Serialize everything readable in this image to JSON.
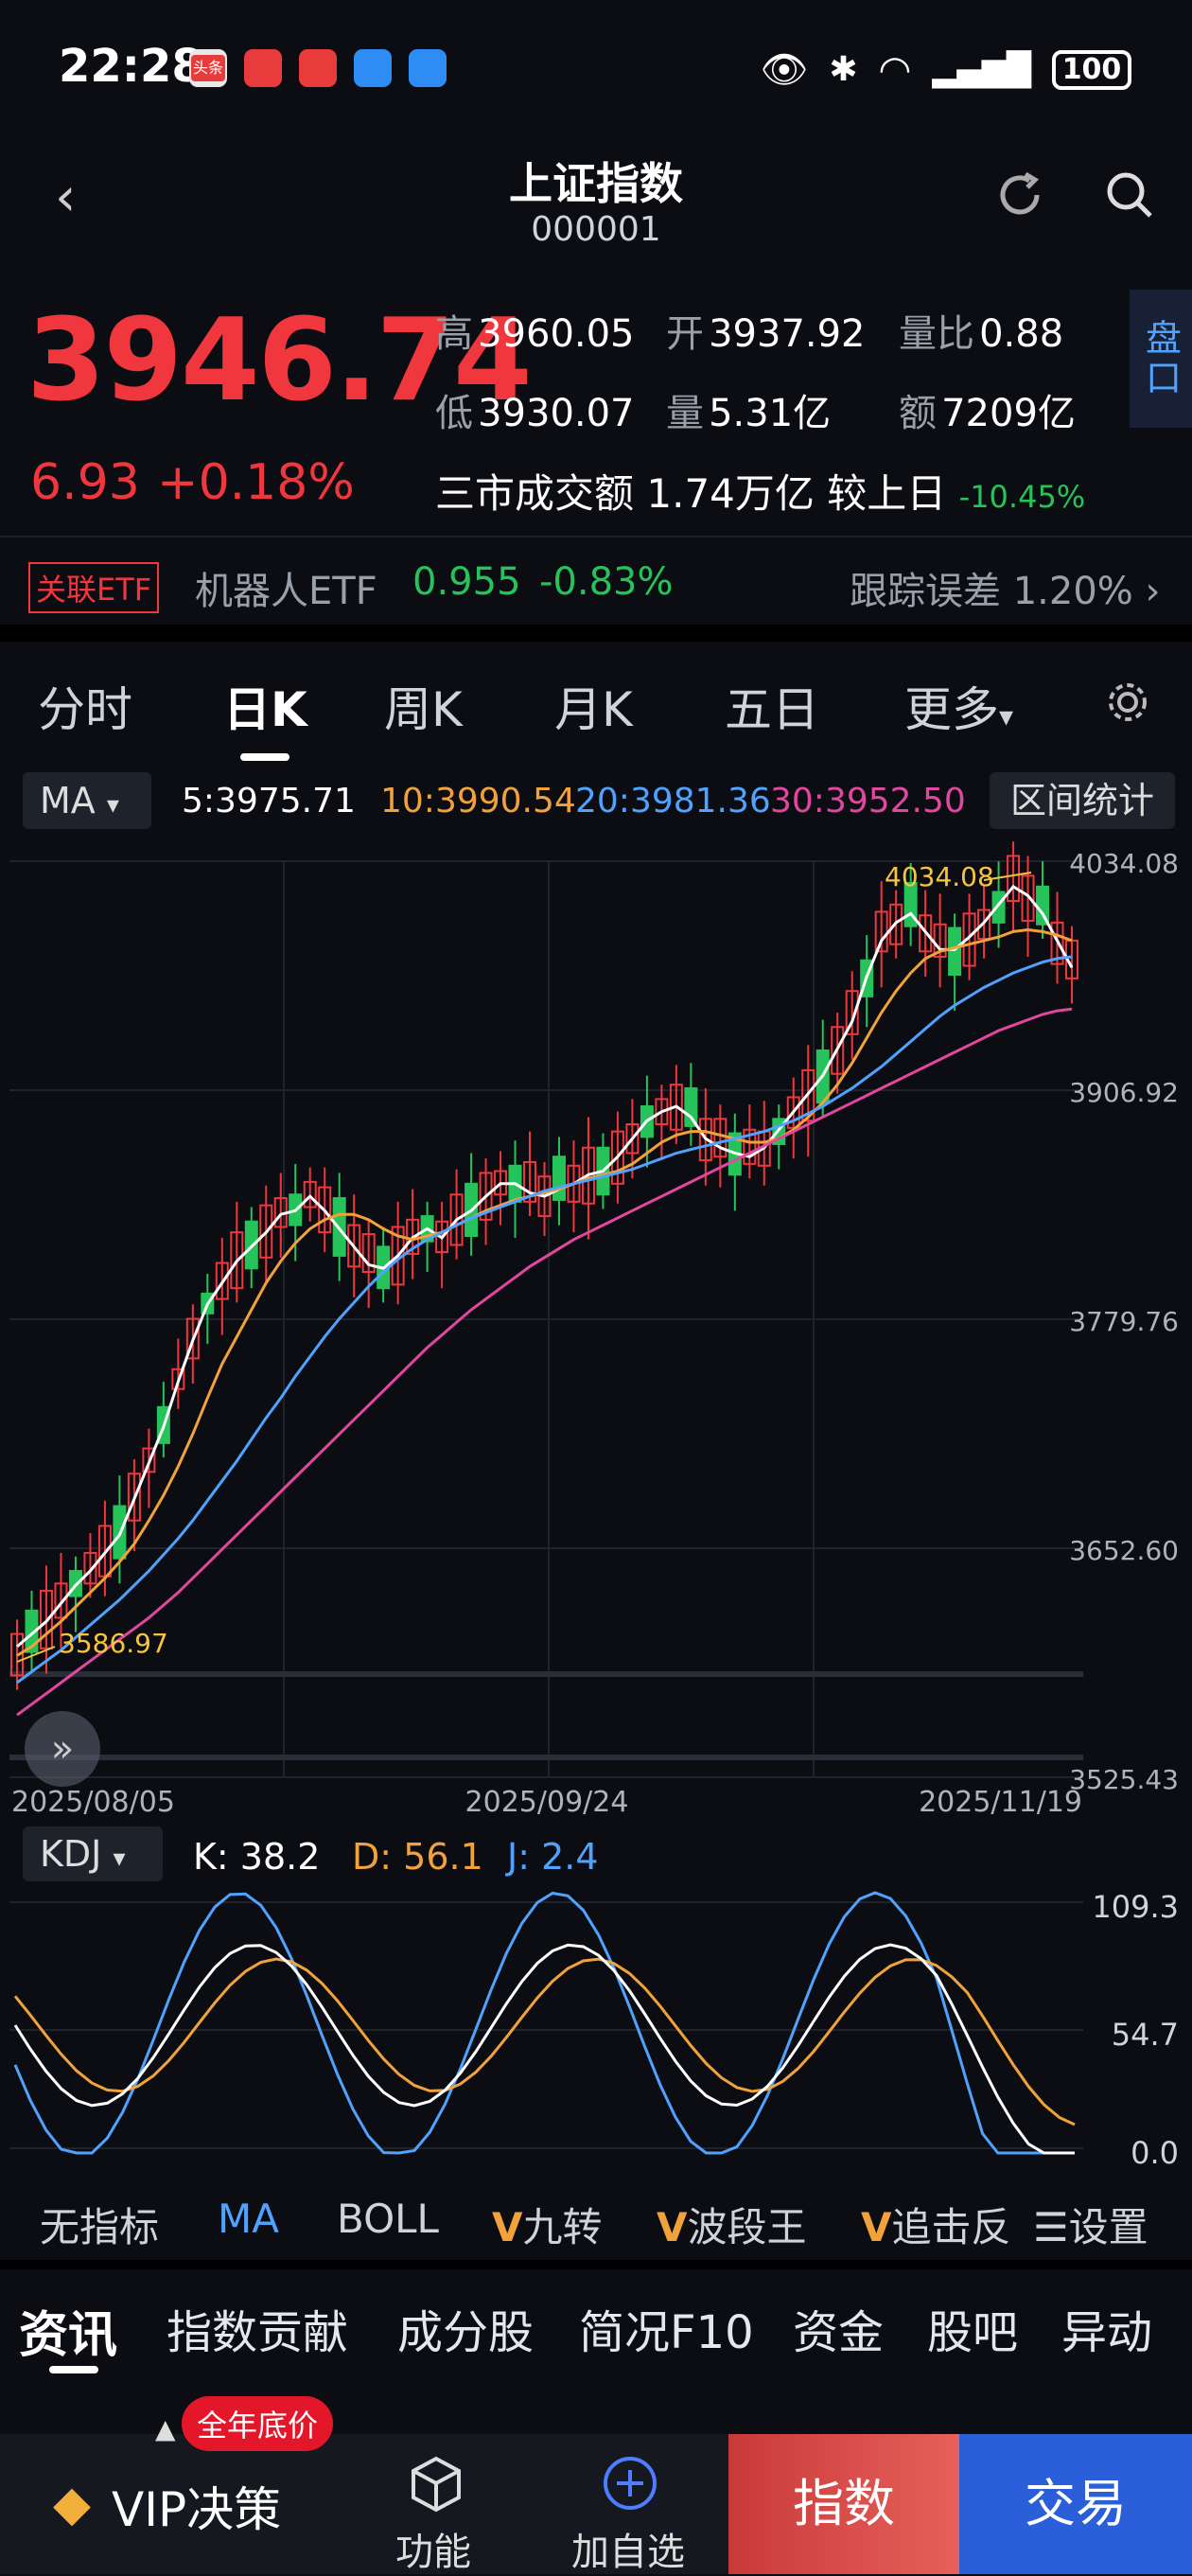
{
  "status": {
    "time": "22:28",
    "app_icons": [
      "头条",
      "huawei",
      "mail",
      "message",
      "browser"
    ],
    "battery": "100"
  },
  "header": {
    "back_icon": "back-icon",
    "title": "上证指数",
    "code": "000001",
    "refresh_icon": "refresh-icon",
    "search_icon": "search-icon"
  },
  "quote": {
    "price": "3946.74",
    "change": "6.93",
    "change_pct": "+0.18%",
    "high_label": "高",
    "high": "3960.05",
    "open_label": "开",
    "open": "3937.92",
    "vol_ratio_label": "量比",
    "vol_ratio": "0.88",
    "low_label": "低",
    "low": "3930.07",
    "vol_label": "量",
    "vol": "5.31亿",
    "amount_label": "额",
    "amount": "7209亿",
    "turnover_label": "三市成交额",
    "turnover": "1.74万亿",
    "vs_label": "较上日",
    "vs_value": "-10.45%",
    "pankou": "盘口"
  },
  "etf": {
    "tag": "关联ETF",
    "name": "机器人ETF",
    "price": "0.955",
    "change": "-0.83%",
    "tracking_label": "跟踪误差",
    "tracking": "1.20%"
  },
  "tabs": [
    "分时",
    "日K",
    "周K",
    "月K",
    "五日",
    "更多"
  ],
  "ma_bar": {
    "selector": "MA",
    "ma5": "5:3975.71",
    "ma10": "10:3990.54",
    "ma20": "20:3981.36",
    "ma30": "30:3952.50",
    "range_stats": "区间统计"
  },
  "chart_data": {
    "type": "candlestick",
    "y_ticks": [
      "4034.08",
      "3906.92",
      "3779.76",
      "3652.60",
      "3525.43"
    ],
    "x_ticks": [
      "2025/08/05",
      "2025/09/24",
      "2025/11/19"
    ],
    "annotations": {
      "high": "4034.08",
      "low": "3586.97"
    },
    "series": [
      {
        "name": "MA5",
        "color": "#ffffff",
        "values": [
          3598,
          3605,
          3612,
          3622,
          3632,
          3640,
          3650,
          3660,
          3680,
          3700,
          3720,
          3745,
          3768,
          3788,
          3800,
          3812,
          3820,
          3828,
          3838,
          3840,
          3848,
          3840,
          3830,
          3820,
          3810,
          3808,
          3815,
          3825,
          3830,
          3825,
          3835,
          3840,
          3848,
          3855,
          3855,
          3850,
          3848,
          3852,
          3855,
          3860,
          3862,
          3870,
          3880,
          3890,
          3895,
          3898,
          3892,
          3880,
          3875,
          3872,
          3870,
          3875,
          3885,
          3895,
          3905,
          3915,
          3930,
          3945,
          3970,
          3990,
          4000,
          4005,
          3995,
          3985,
          3985,
          3992,
          4000,
          4010,
          4020,
          4015,
          4005,
          3990,
          3975
        ]
      },
      {
        "name": "MA10",
        "color": "#f2a23b",
        "values": [
          3593,
          3598,
          3605,
          3612,
          3620,
          3628,
          3636,
          3645,
          3655,
          3668,
          3682,
          3698,
          3716,
          3736,
          3755,
          3770,
          3785,
          3800,
          3812,
          3822,
          3830,
          3835,
          3838,
          3838,
          3835,
          3830,
          3826,
          3824,
          3826,
          3828,
          3832,
          3836,
          3840,
          3843,
          3846,
          3848,
          3850,
          3852,
          3855,
          3858,
          3860,
          3862,
          3866,
          3872,
          3878,
          3882,
          3884,
          3884,
          3882,
          3880,
          3878,
          3878,
          3880,
          3885,
          3892,
          3900,
          3910,
          3922,
          3936,
          3950,
          3962,
          3972,
          3980,
          3984,
          3986,
          3988,
          3990,
          3992,
          3995,
          3996,
          3995,
          3993,
          3990
        ]
      },
      {
        "name": "MA20",
        "color": "#4fa3ff",
        "values": [
          3578,
          3584,
          3590,
          3596,
          3603,
          3610,
          3617,
          3624,
          3632,
          3640,
          3649,
          3658,
          3668,
          3679,
          3690,
          3701,
          3713,
          3725,
          3736,
          3748,
          3759,
          3770,
          3780,
          3789,
          3798,
          3806,
          3813,
          3819,
          3824,
          3828,
          3832,
          3836,
          3839,
          3842,
          3845,
          3848,
          3851,
          3853,
          3855,
          3857,
          3859,
          3861,
          3863,
          3866,
          3869,
          3872,
          3874,
          3876,
          3878,
          3880,
          3882,
          3884,
          3887,
          3890,
          3894,
          3898,
          3903,
          3908,
          3914,
          3920,
          3927,
          3934,
          3941,
          3948,
          3954,
          3959,
          3964,
          3968,
          3972,
          3975,
          3978,
          3980,
          3981
        ]
      },
      {
        "name": "MA30",
        "color": "#e0479e",
        "values": [
          3560,
          3566,
          3572,
          3578,
          3584,
          3590,
          3596,
          3602,
          3608,
          3614,
          3621,
          3628,
          3636,
          3644,
          3652,
          3660,
          3668,
          3676,
          3684,
          3692,
          3700,
          3708,
          3716,
          3724,
          3732,
          3740,
          3748,
          3756,
          3764,
          3771,
          3778,
          3785,
          3791,
          3797,
          3803,
          3809,
          3814,
          3819,
          3824,
          3828,
          3832,
          3836,
          3840,
          3844,
          3848,
          3852,
          3856,
          3860,
          3864,
          3868,
          3872,
          3876,
          3880,
          3884,
          3888,
          3892,
          3896,
          3900,
          3904,
          3908,
          3912,
          3916,
          3920,
          3924,
          3928,
          3932,
          3936,
          3940,
          3943,
          3946,
          3949,
          3951,
          3952
        ]
      }
    ]
  },
  "kdj": {
    "selector": "KDJ",
    "k": "K: 38.2",
    "d": "D: 56.1",
    "j": "J: 2.4",
    "y_ticks": [
      "109.3",
      "54.7",
      "0.0"
    ]
  },
  "indicators": [
    "无指标",
    "MA",
    "BOLL",
    "九转",
    "波段王",
    "追击反",
    "设置"
  ],
  "bottom_tabs": [
    "资讯",
    "指数贡献",
    "成分股",
    "简况F10",
    "资金",
    "股吧",
    "异动"
  ],
  "footer": {
    "promo": "全年底价",
    "vip": "VIP决策",
    "func": "功能",
    "add": "加自选",
    "index": "指数",
    "trade": "交易"
  }
}
